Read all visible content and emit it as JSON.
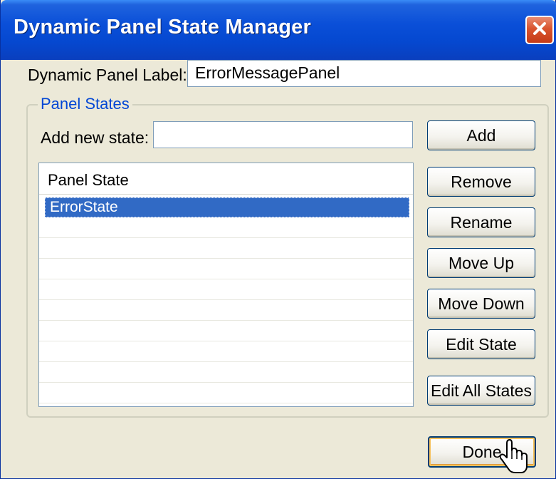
{
  "window": {
    "title": "Dynamic Panel State Manager"
  },
  "form": {
    "panel_label_label": "Dynamic Panel Label:",
    "panel_label_value": "ErrorMessagePanel",
    "group_title": "Panel States",
    "add_state_label": "Add new state:",
    "add_state_value": ""
  },
  "list": {
    "header": "Panel State",
    "items": [
      "ErrorState",
      "",
      "",
      "",
      "",
      "",
      "",
      "",
      "",
      ""
    ],
    "selected_index": 0
  },
  "buttons": {
    "add": "Add",
    "remove": "Remove",
    "rename": "Rename",
    "move_up": "Move Up",
    "move_down": "Move Down",
    "edit_state": "Edit State",
    "edit_all_states": "Edit All States",
    "done": "Done"
  },
  "icons": {
    "close": "close-icon",
    "cursor": "pointer-cursor-icon"
  },
  "colors": {
    "titlebar": "#0a4fd8",
    "selection": "#316ac5",
    "close_button": "#d9542f",
    "group_legend": "#0046d5"
  }
}
